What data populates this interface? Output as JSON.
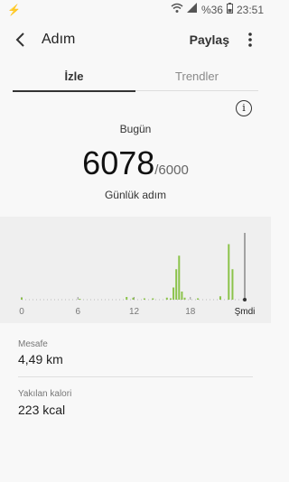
{
  "status_bar": {
    "battery_percent": "%36",
    "time": "23:51",
    "icons": [
      "wifi-icon",
      "signal-icon",
      "battery-icon"
    ]
  },
  "header": {
    "title": "Adım",
    "share_label": "Paylaş"
  },
  "tabs": [
    {
      "label": "İzle",
      "active": true
    },
    {
      "label": "Trendler",
      "active": false
    }
  ],
  "summary": {
    "day_label": "Bugün",
    "steps": "6078",
    "goal": "/6000",
    "unit_label": "Günlük adım"
  },
  "chart": {
    "x_tick_labels": [
      "0",
      "6",
      "12",
      "18",
      "Şmdi"
    ],
    "bar_color": "#8bc34a",
    "hourly_bars": [
      {
        "hour": 0,
        "value": 0.03
      },
      {
        "hour": 6.2,
        "value": 0.01
      },
      {
        "hour": 11.2,
        "value": 0.04
      },
      {
        "hour": 11.9,
        "value": 0.03
      },
      {
        "hour": 13.1,
        "value": 0.02
      },
      {
        "hour": 14.0,
        "value": 0.02
      },
      {
        "hour": 15.5,
        "value": 0.03
      },
      {
        "hour": 15.9,
        "value": 0.02
      },
      {
        "hour": 16.2,
        "value": 0.18
      },
      {
        "hour": 16.5,
        "value": 0.45
      },
      {
        "hour": 16.8,
        "value": 0.65
      },
      {
        "hour": 17.1,
        "value": 0.12
      },
      {
        "hour": 17.4,
        "value": 0.03
      },
      {
        "hour": 18.8,
        "value": 0.02
      },
      {
        "hour": 21.2,
        "value": 0.05
      },
      {
        "hour": 22.1,
        "value": 0.82
      },
      {
        "hour": 22.5,
        "value": 0.45
      }
    ]
  },
  "stats": [
    {
      "label": "Mesafe",
      "value": "4,49 km"
    },
    {
      "label": "Yakılan kalori",
      "value": "223 kcal"
    }
  ]
}
